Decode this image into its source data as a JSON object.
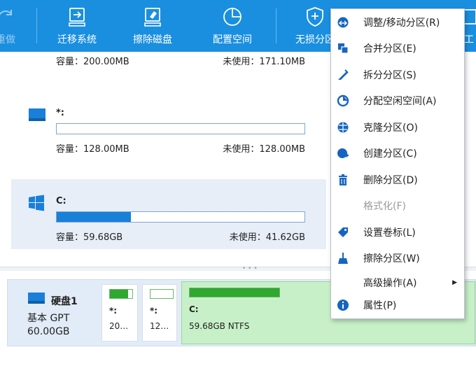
{
  "toolbar": {
    "items": [
      {
        "label": "重做",
        "icon": "redo-icon"
      },
      {
        "label": "迁移系统",
        "icon": "migrate-os-icon"
      },
      {
        "label": "擦除磁盘",
        "icon": "wipe-disk-icon"
      },
      {
        "label": "配置空间",
        "icon": "allocate-space-icon"
      },
      {
        "label": "无损分区",
        "icon": "shield-icon"
      },
      {
        "label": "工",
        "icon": "tools-icon"
      }
    ]
  },
  "partitions": [
    {
      "name": "",
      "capacity": "容量：200.00MB",
      "free": "未使用：171.10MB",
      "used_fraction": 0.15
    },
    {
      "name": "*:",
      "capacity": "容量：128.00MB",
      "free": "未使用：128.00MB",
      "used_fraction": 0.0
    },
    {
      "name": "C:",
      "capacity": "容量：59.68GB",
      "free": "未使用：41.62GB",
      "used_fraction": 0.3,
      "selected": true
    }
  ],
  "disk": {
    "name": "硬盘1",
    "type": "基本 GPT",
    "size": "60.00GB",
    "segments": [
      {
        "name": "*:",
        "size": "20…",
        "used_fraction": 0.8
      },
      {
        "name": "*:",
        "size": "12…",
        "used_fraction": 0.0
      },
      {
        "name": "C:",
        "size": "59.68GB NTFS",
        "used_fraction": 0.35
      }
    ]
  },
  "context_menu": {
    "items": [
      {
        "label": "调整/移动分区(R)",
        "icon": "resize-move-icon",
        "enabled": true
      },
      {
        "label": "合并分区(E)",
        "icon": "merge-icon",
        "enabled": true
      },
      {
        "label": "拆分分区(S)",
        "icon": "split-icon",
        "enabled": true
      },
      {
        "label": "分配空闲空间(A)",
        "icon": "allocate-free-space-icon",
        "enabled": true
      },
      {
        "label": "克隆分区(O)",
        "icon": "clone-icon",
        "enabled": true
      },
      {
        "label": "创建分区(C)",
        "icon": "create-partition-icon",
        "enabled": true
      },
      {
        "label": "删除分区(D)",
        "icon": "trash-icon",
        "enabled": true
      },
      {
        "label": "格式化(F)",
        "icon": "",
        "enabled": false
      },
      {
        "label": "设置卷标(L)",
        "icon": "tag-icon",
        "enabled": true
      },
      {
        "label": "擦除分区(W)",
        "icon": "broom-icon",
        "enabled": true
      },
      {
        "label": "高级操作(A)",
        "icon": "",
        "enabled": true,
        "submenu": true
      },
      {
        "label": "属性(P)",
        "icon": "info-icon",
        "enabled": true
      }
    ]
  },
  "colors": {
    "toolbar": "#1a8fe0",
    "accent": "#1a7fd8",
    "menu_icon": "#1565c0"
  }
}
